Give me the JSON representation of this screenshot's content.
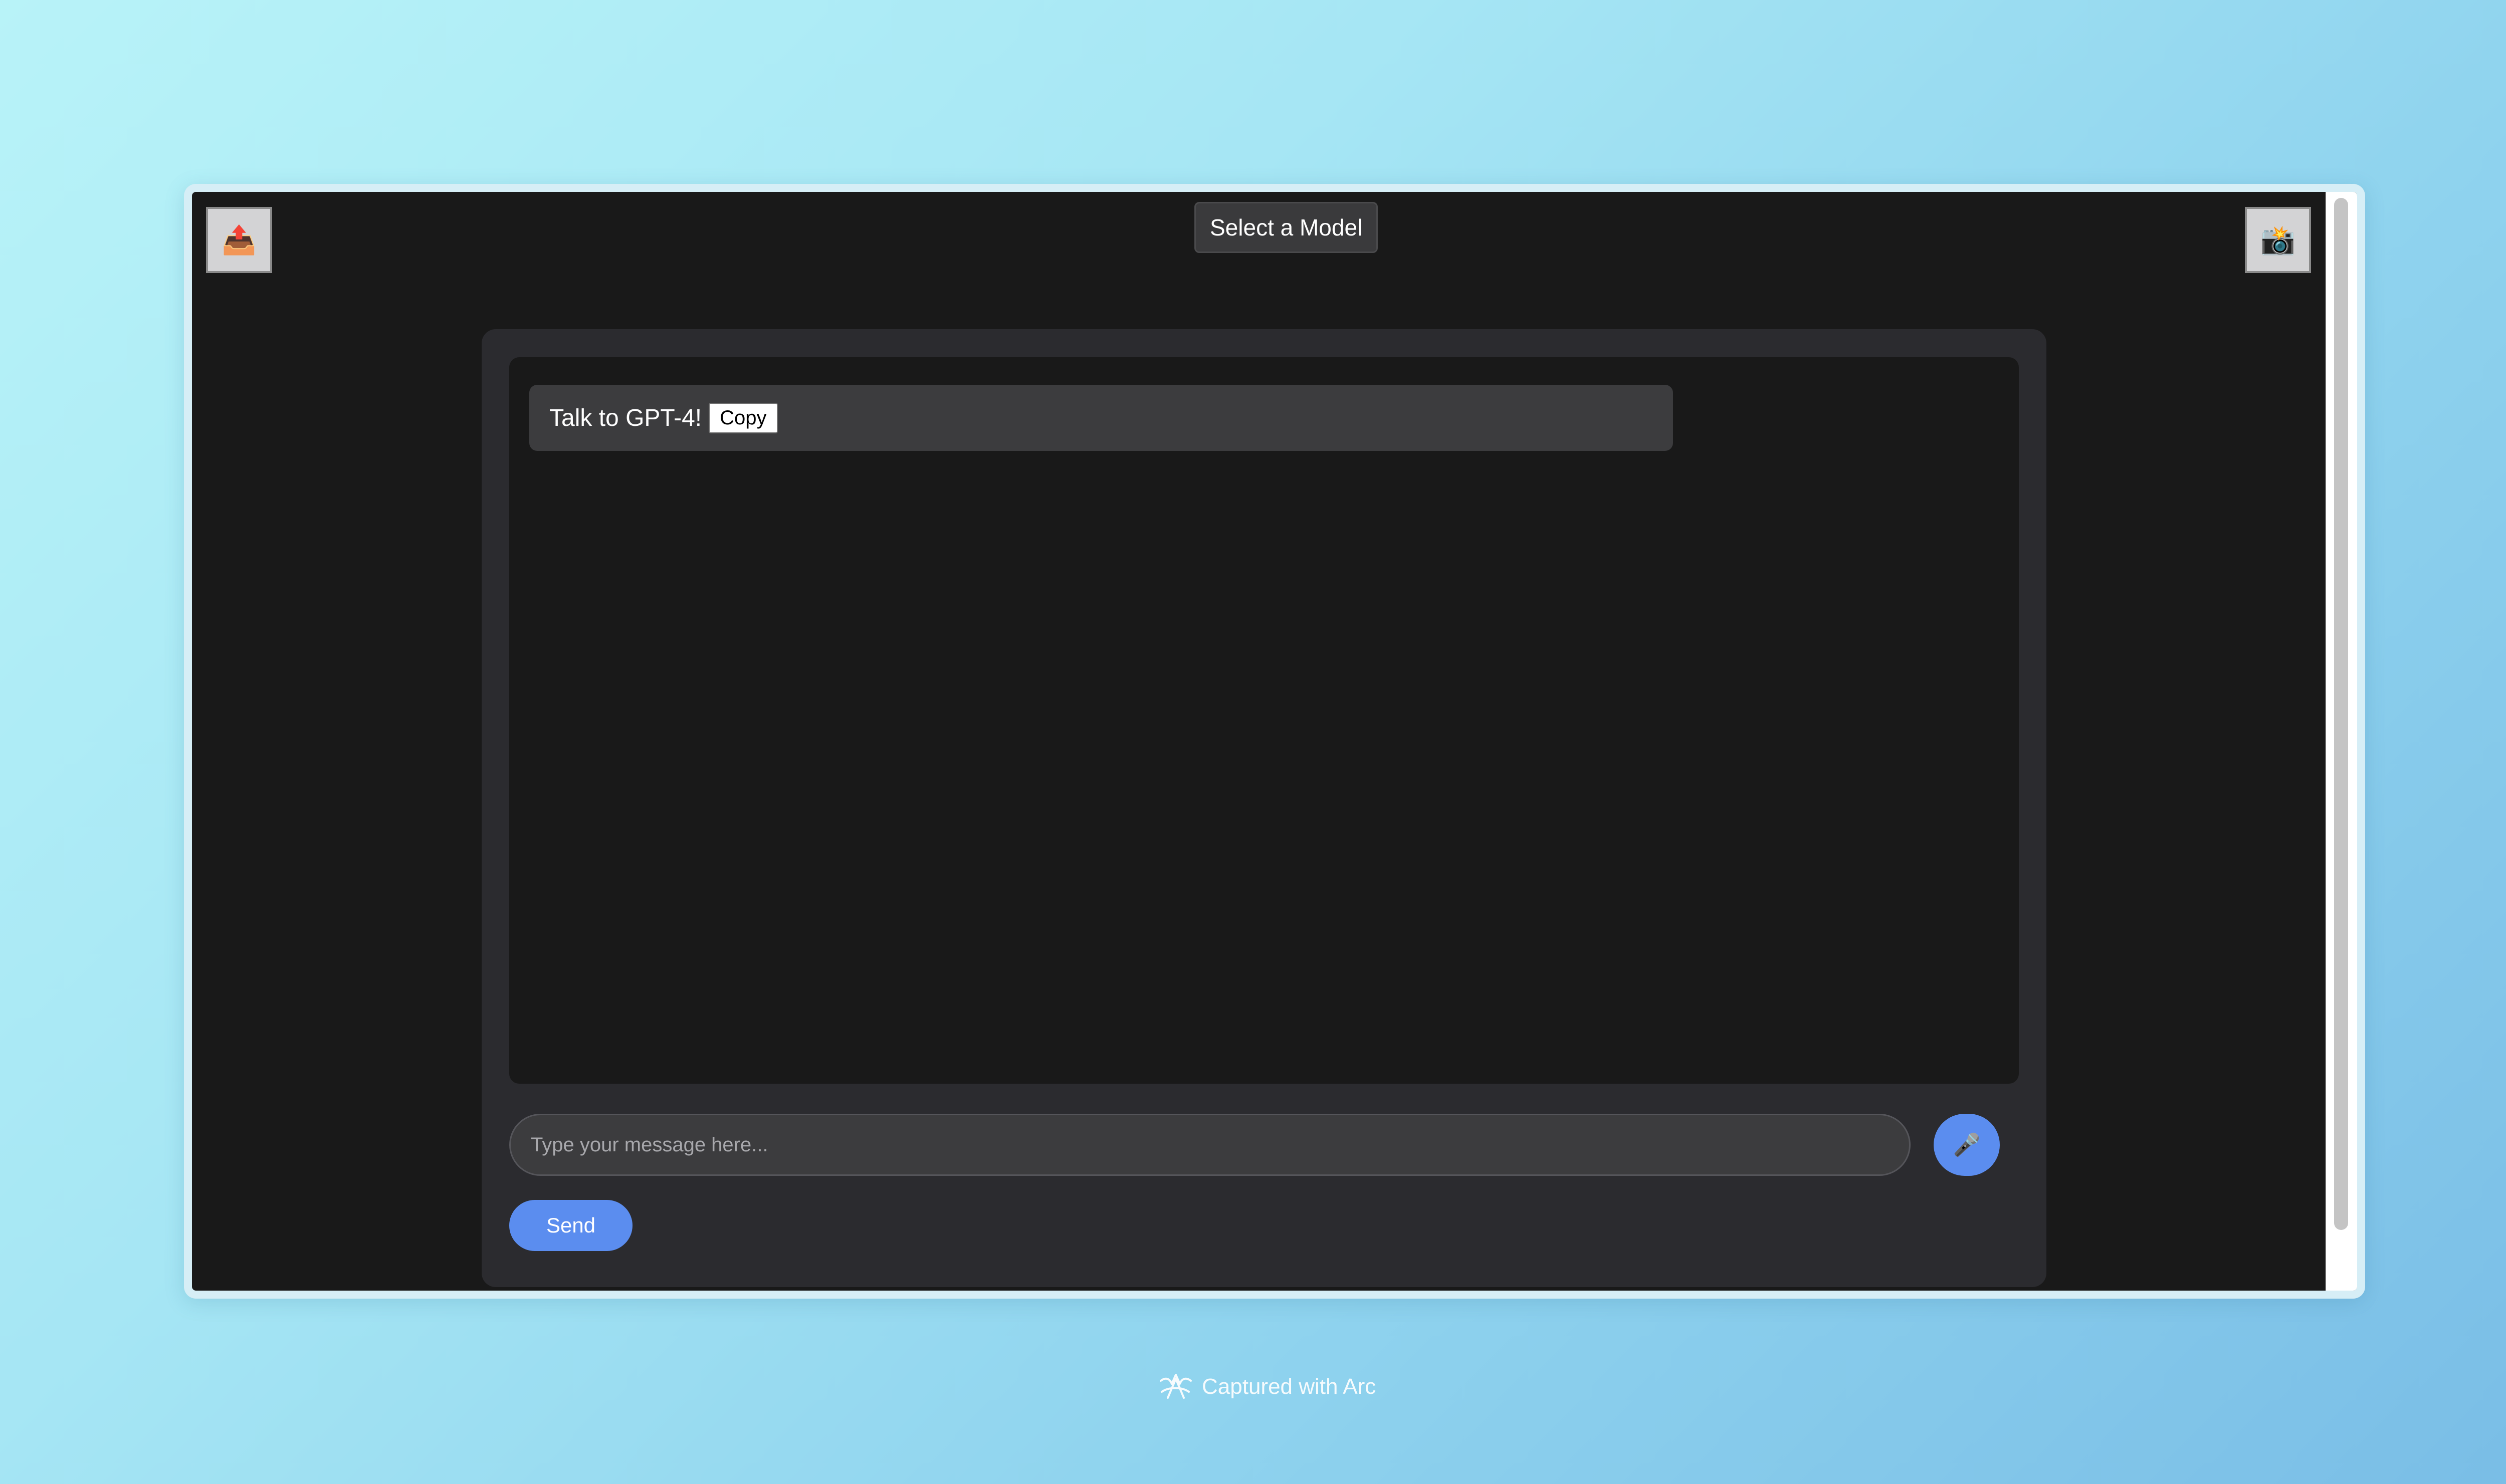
{
  "toolbar": {
    "left_button_icon": "📤",
    "right_button_icon": "📸",
    "model_select_label": "Select a Model"
  },
  "chat": {
    "messages": [
      {
        "text": "Talk to GPT-4!",
        "copy_label": "Copy"
      }
    ],
    "input": {
      "value": "",
      "placeholder": "Type your message here..."
    },
    "mic_icon": "🎤",
    "send_label": "Send"
  },
  "footer": {
    "capture_text": "Captured with Arc"
  },
  "colors": {
    "page_bg": "#191919",
    "card_bg": "#2b2b2f",
    "accent": "#5b8def"
  }
}
